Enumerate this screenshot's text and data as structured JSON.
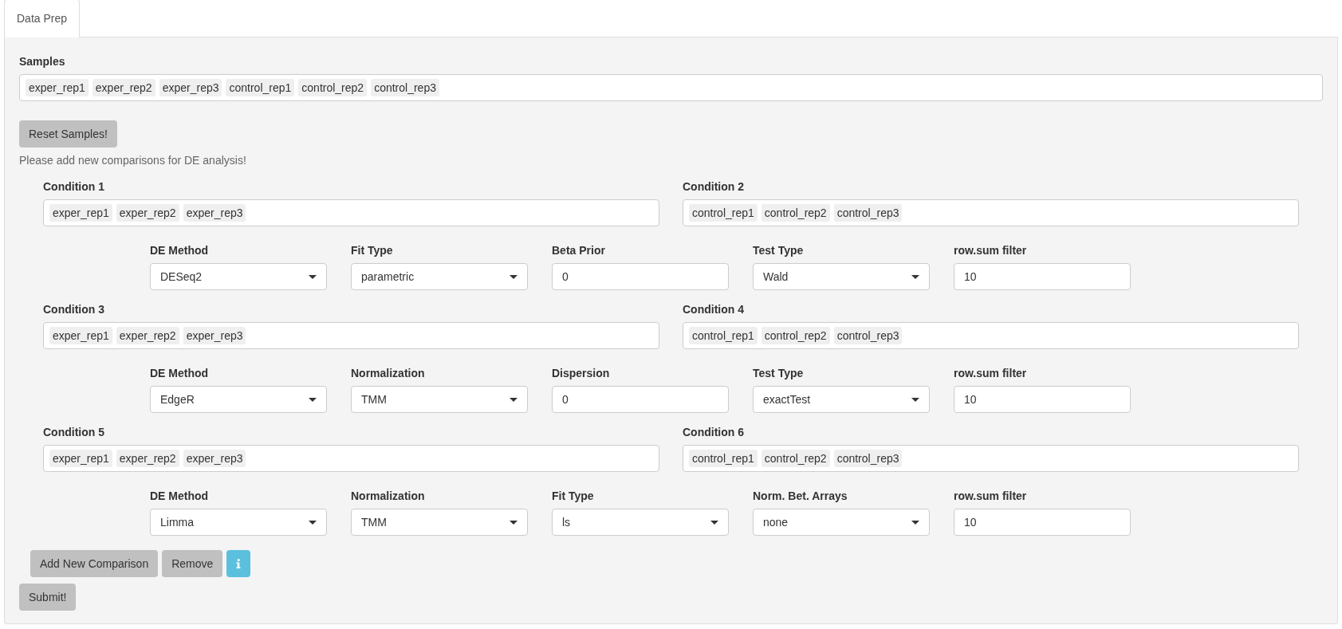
{
  "tabs": [
    {
      "label": "Data Prep",
      "selected": true
    }
  ],
  "samples": {
    "label": "Samples",
    "tags": [
      "exper_rep1",
      "exper_rep2",
      "exper_rep3",
      "control_rep1",
      "control_rep2",
      "control_rep3"
    ]
  },
  "reset_button": "Reset Samples!",
  "hint": "Please add new comparisons for DE analysis!",
  "comparisons": [
    {
      "conditions": [
        {
          "label": "Condition 1",
          "tags": [
            "exper_rep1",
            "exper_rep2",
            "exper_rep3"
          ]
        },
        {
          "label": "Condition 2",
          "tags": [
            "control_rep1",
            "control_rep2",
            "control_rep3"
          ]
        }
      ],
      "params": [
        {
          "label": "DE Method",
          "kind": "select",
          "value": "DESeq2"
        },
        {
          "label": "Fit Type",
          "kind": "select",
          "value": "parametric"
        },
        {
          "label": "Beta Prior",
          "kind": "text",
          "value": "0"
        },
        {
          "label": "Test Type",
          "kind": "select",
          "value": "Wald"
        },
        {
          "label": "row.sum filter",
          "kind": "text",
          "value": "10"
        }
      ]
    },
    {
      "conditions": [
        {
          "label": "Condition 3",
          "tags": [
            "exper_rep1",
            "exper_rep2",
            "exper_rep3"
          ]
        },
        {
          "label": "Condition 4",
          "tags": [
            "control_rep1",
            "control_rep2",
            "control_rep3"
          ]
        }
      ],
      "params": [
        {
          "label": "DE Method",
          "kind": "select",
          "value": "EdgeR"
        },
        {
          "label": "Normalization",
          "kind": "select",
          "value": "TMM"
        },
        {
          "label": "Dispersion",
          "kind": "text",
          "value": "0"
        },
        {
          "label": "Test Type",
          "kind": "select",
          "value": "exactTest"
        },
        {
          "label": "row.sum filter",
          "kind": "text",
          "value": "10"
        }
      ]
    },
    {
      "conditions": [
        {
          "label": "Condition 5",
          "tags": [
            "exper_rep1",
            "exper_rep2",
            "exper_rep3"
          ]
        },
        {
          "label": "Condition 6",
          "tags": [
            "control_rep1",
            "control_rep2",
            "control_rep3"
          ]
        }
      ],
      "params": [
        {
          "label": "DE Method",
          "kind": "select",
          "value": "Limma"
        },
        {
          "label": "Normalization",
          "kind": "select",
          "value": "TMM"
        },
        {
          "label": "Fit Type",
          "kind": "select",
          "value": "ls"
        },
        {
          "label": "Norm. Bet. Arrays",
          "kind": "select",
          "value": "none"
        },
        {
          "label": "row.sum filter",
          "kind": "text",
          "value": "10"
        }
      ]
    }
  ],
  "actions": [
    {
      "kind": "default",
      "label": "Add New Comparison"
    },
    {
      "kind": "default",
      "label": "Remove"
    },
    {
      "kind": "info"
    }
  ],
  "submit_button": "Submit!"
}
